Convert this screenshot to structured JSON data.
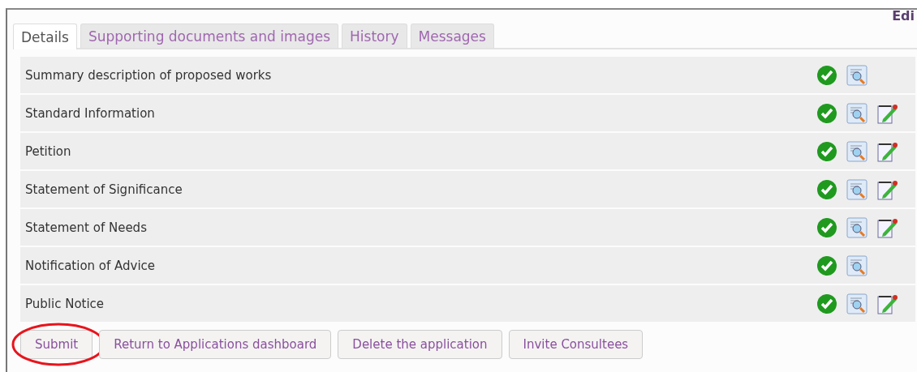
{
  "header_link": "Edi",
  "tabs": [
    {
      "label": "Details",
      "selected": true
    },
    {
      "label": "Supporting documents and images",
      "selected": false
    },
    {
      "label": "History",
      "selected": false
    },
    {
      "label": "Messages",
      "selected": false
    }
  ],
  "sections": [
    {
      "label": "Summary description of proposed works",
      "complete": true,
      "editable": false
    },
    {
      "label": "Standard Information",
      "complete": true,
      "editable": true
    },
    {
      "label": "Petition",
      "complete": true,
      "editable": true
    },
    {
      "label": "Statement of Significance",
      "complete": true,
      "editable": true
    },
    {
      "label": "Statement of Needs",
      "complete": true,
      "editable": true
    },
    {
      "label": "Notification of Advice",
      "complete": true,
      "editable": false
    },
    {
      "label": "Public Notice",
      "complete": true,
      "editable": true
    }
  ],
  "buttons": [
    {
      "label": "Submit",
      "circled": true
    },
    {
      "label": "Return to Applications dashboard",
      "circled": false
    },
    {
      "label": "Delete the application",
      "circled": false
    },
    {
      "label": "Invite Consultees",
      "circled": false
    }
  ]
}
